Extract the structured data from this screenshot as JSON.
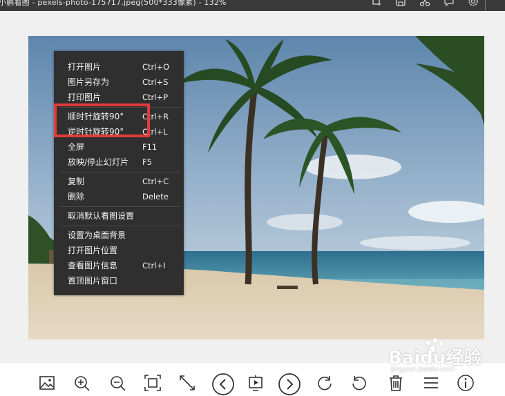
{
  "window": {
    "title": "小鹏看图 - pexels-photo-175717.jpeg(500*333像素) - 132%",
    "title_icons": [
      "crop-icon",
      "save-icon",
      "scissors-icon",
      "feedback-icon",
      "settings-icon"
    ]
  },
  "context_menu": {
    "items": [
      {
        "label": "打开图片",
        "shortcut": "Ctrl+O"
      },
      {
        "label": "图片另存为",
        "shortcut": "Ctrl+S"
      },
      {
        "label": "打印图片",
        "shortcut": "Ctrl+P"
      },
      {
        "label": "顺时针旋转90°",
        "shortcut": "Ctrl+R"
      },
      {
        "label": "逆时针旋转90°",
        "shortcut": "Ctrl+L"
      },
      {
        "label": "全屏",
        "shortcut": "F11"
      },
      {
        "label": "放映/停止幻灯片",
        "shortcut": "F5"
      },
      {
        "label": "复制",
        "shortcut": "Ctrl+C"
      },
      {
        "label": "删除",
        "shortcut": "Delete"
      },
      {
        "label": "取消默认看图设置",
        "shortcut": ""
      },
      {
        "label": "设置为桌面背景",
        "shortcut": ""
      },
      {
        "label": "打开图片位置",
        "shortcut": ""
      },
      {
        "label": "查看图片信息",
        "shortcut": "Ctrl+I"
      },
      {
        "label": "置顶图片窗口",
        "shortcut": ""
      }
    ],
    "highlighted_item": "逆时针旋转90°",
    "highlight_color": "#e33a3a"
  },
  "toolbar": {
    "buttons": [
      "image-icon",
      "zoom-in-icon",
      "zoom-out-icon",
      "fit-screen-icon",
      "expand-icon",
      "previous-icon",
      "slideshow-icon",
      "next-icon",
      "rotate-clockwise-icon",
      "rotate-counterclockwise-icon",
      "delete-icon",
      "menu-icon",
      "info-icon"
    ]
  },
  "watermark": {
    "brand": "Baidu经验",
    "url": "jingyan.baidu.com"
  },
  "colors": {
    "titlebar": "#3a3a3a",
    "menu_bg": "#2f2f2f",
    "viewer_bg": "#f0f0f0"
  }
}
